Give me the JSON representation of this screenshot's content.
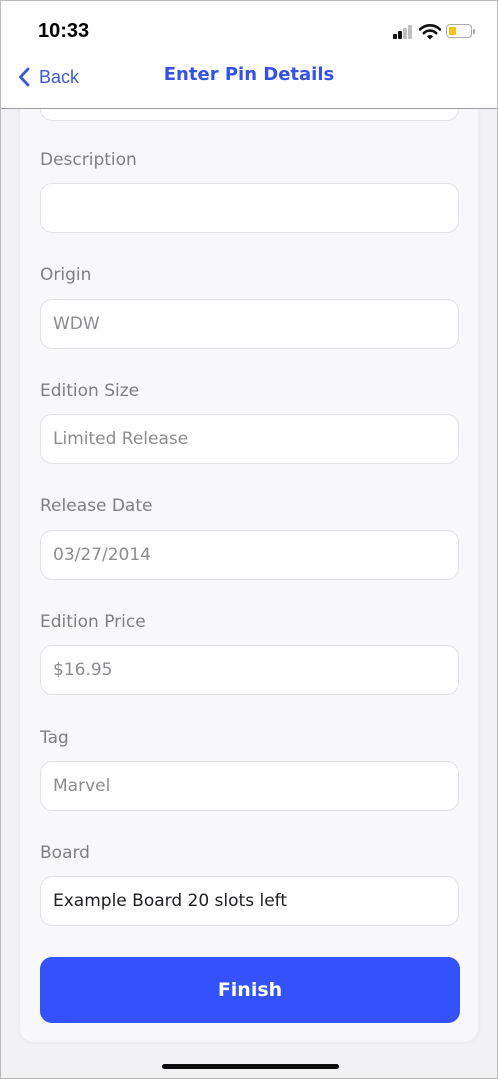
{
  "status_bar": {
    "time": "10:33",
    "icons": [
      "cellular-signal-icon",
      "wifi-icon",
      "battery-icon"
    ],
    "battery_level": 0.35
  },
  "nav": {
    "back_label": "Back",
    "title": "Enter Pin Details"
  },
  "form": {
    "fields": [
      {
        "label": "Description",
        "value": ""
      },
      {
        "label": "Origin",
        "value": "WDW"
      },
      {
        "label": "Edition Size",
        "value": "Limited Release"
      },
      {
        "label": "Release Date",
        "value": "03/27/2014"
      },
      {
        "label": "Edition Price",
        "value": "$16.95"
      },
      {
        "label": "Tag",
        "value": "Marvel"
      },
      {
        "label": "Board",
        "value": "Example Board 20 slots left"
      }
    ],
    "finish_label": "Finish"
  },
  "colors": {
    "accent": "#3452fb",
    "nav_title": "#3552e8",
    "back": "#3a5bd9",
    "battery": "#f5c518"
  }
}
